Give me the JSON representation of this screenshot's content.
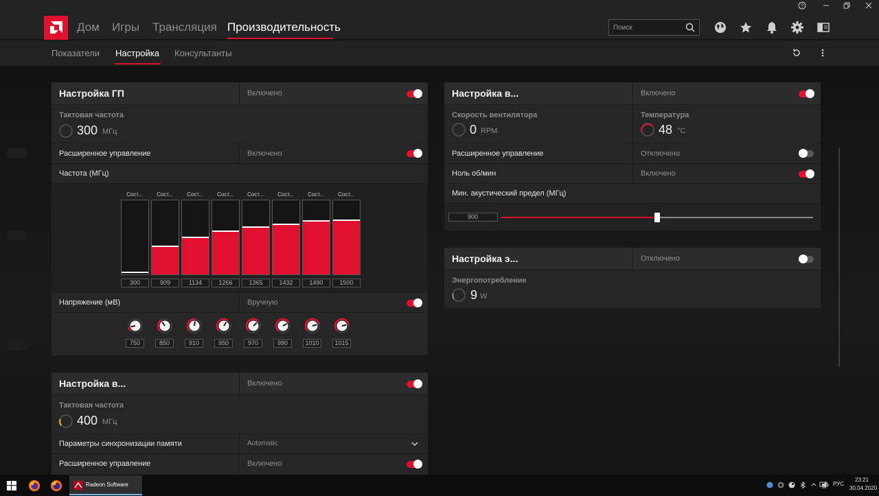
{
  "top_nav": {
    "tabs": [
      "Дом",
      "Игры",
      "Трансляция",
      "Производительность"
    ],
    "active_tab": "Производительность",
    "search_placeholder": "Поиск"
  },
  "sub_nav": {
    "tabs": [
      "Показатели",
      "Настройка",
      "Консультанты"
    ],
    "active_tab": "Настройка"
  },
  "gpu_tuning": {
    "title": "Настройка ГП",
    "status": "Включено",
    "enabled": true,
    "clock_label": "Тактовая частота",
    "clock_value": "300",
    "clock_unit": "МГц",
    "advanced_label": "Расширенное управление",
    "advanced_status": "Включено",
    "freq_label": "Частота (МГц)",
    "state_label": "Сост...",
    "freq_states": [
      {
        "value": 300,
        "fill": 0.0
      },
      {
        "value": 909,
        "fill": 0.37
      },
      {
        "value": 1134,
        "fill": 0.49
      },
      {
        "value": 1266,
        "fill": 0.57
      },
      {
        "value": 1365,
        "fill": 0.63
      },
      {
        "value": 1432,
        "fill": 0.67
      },
      {
        "value": 1490,
        "fill": 0.71
      },
      {
        "value": 1500,
        "fill": 0.72
      }
    ],
    "voltage_label": "Напряжение (мВ)",
    "voltage_status": "Вручную",
    "voltages": [
      750,
      850,
      910,
      950,
      970,
      990,
      1010,
      1015
    ]
  },
  "vram_tuning": {
    "title": "Настройка в...",
    "status": "Включено",
    "clock_label": "Тактовая частота",
    "clock_value": "400",
    "clock_unit": "МГц",
    "timing_label": "Параметры синхронизации памяти",
    "timing_value": "Automatic",
    "advanced_label": "Расширенное управление",
    "advanced_status": "Включено"
  },
  "fan_tuning": {
    "title": "Настройка в...",
    "status": "Включено",
    "fan_speed_label": "Скорость вентилятора",
    "fan_speed_value": "0",
    "fan_speed_unit": "RPM",
    "temp_label": "Температура",
    "temp_value": "48",
    "temp_unit": "°C",
    "advanced_label": "Расширенное управление",
    "advanced_status": "Отключено",
    "zero_rpm_label": "Ноль об/мин",
    "zero_rpm_status": "Включено",
    "acoustic_label": "Мин. акустический предел (МГц)",
    "acoustic_value": "900",
    "acoustic_fraction": 0.5
  },
  "power_tuning": {
    "title": "Настройка э...",
    "status": "Отключено",
    "power_label": "Энергопотребление",
    "power_value": "9",
    "power_unit": "W"
  },
  "taskbar": {
    "active_app": "Radeon Software",
    "language": "РУС",
    "time": "23:21",
    "date": "30.04.2020"
  },
  "colors": {
    "accent": "#e0102f",
    "panel": "#262626",
    "background": "#161616"
  }
}
